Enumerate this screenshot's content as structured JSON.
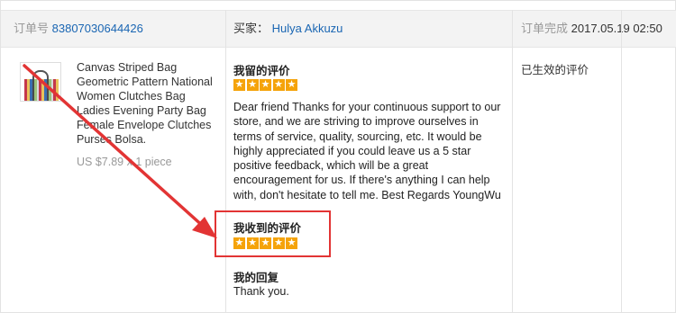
{
  "header": {
    "order_label": "订单号",
    "order_number": "83807030644426",
    "buyer_label": "买家：",
    "buyer_name": "Hulya Akkuzu",
    "completed_label": "订单完成",
    "completed_time": "2017.05.19 02:50"
  },
  "product": {
    "title": "Canvas Striped Bag Geometric Pattern National Women Clutches Bag Ladies Evening Party Bag Female Envelope Clutches Purses Bolsa.",
    "price": "US $7.89 x 1 piece"
  },
  "review": {
    "my_review_title": "我留的评价",
    "my_review_stars": 5,
    "my_review_text": "Dear friend Thanks for your continuous support to our store, and we are striving to improve ourselves in terms of service, quality, sourcing, etc. It would be highly appreciated if you could leave us a 5 star positive feedback, which will be a great encouragement for us. If there's anything I can help with, don't hesitate to tell me. Best Regards YoungWu",
    "received_review_title": "我收到的评价",
    "received_review_stars": 5,
    "my_reply_title": "我的回复",
    "my_reply_text": "Thank you."
  },
  "status": {
    "text": "已生效的评价"
  },
  "colors": {
    "link": "#1a66b3",
    "star": "#f5a30a",
    "highlight": "#e23434"
  },
  "icons": {
    "star": "star-icon",
    "annotation": "red-arrow-annotation"
  }
}
